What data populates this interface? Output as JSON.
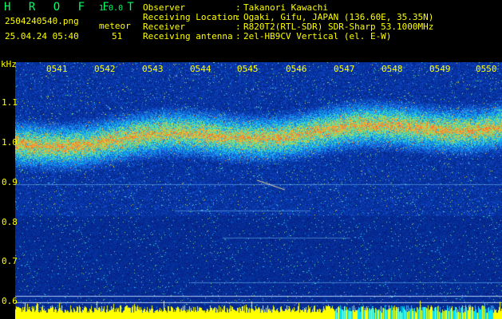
{
  "header": {
    "app_title": "H R O F F T",
    "app_version": "1.0.0",
    "file_name": "2504240540.png",
    "meteor_label": "meteor",
    "datetime": "25.04.24 05:40",
    "meteor_count": "51"
  },
  "info": [
    {
      "label": "Observer",
      "value": "Takanori Kawachi"
    },
    {
      "label": "Receiving Location",
      "value": "Ogaki, Gifu, JAPAN (136.60E, 35.35N)"
    },
    {
      "label": "Receiver",
      "value": "R820T2(RTL-SDR) SDR-Sharp 53.1000MHz"
    },
    {
      "label": "Receiving antenna",
      "value": "2el-HB9CV Vertical (el. E-W)"
    }
  ],
  "info_separator": ":",
  "axis": {
    "y_unit": "kHz",
    "y_ticks": [
      "1.1",
      "1.0",
      "0.9",
      "0.8",
      "0.7",
      "0.6"
    ],
    "x_ticks": [
      "0541",
      "0542",
      "0543",
      "0544",
      "0545",
      "0546",
      "0547",
      "0548",
      "0549",
      "0550"
    ]
  },
  "colors": {
    "background": "#000000",
    "label": "#ffff00",
    "title": "#00ff66",
    "spectrum_base": "#0a1f9a",
    "spectrum_bright": "#3ad0ff",
    "bar_yellow": "#ffff00",
    "bar_cyan": "#00e0ff"
  }
}
